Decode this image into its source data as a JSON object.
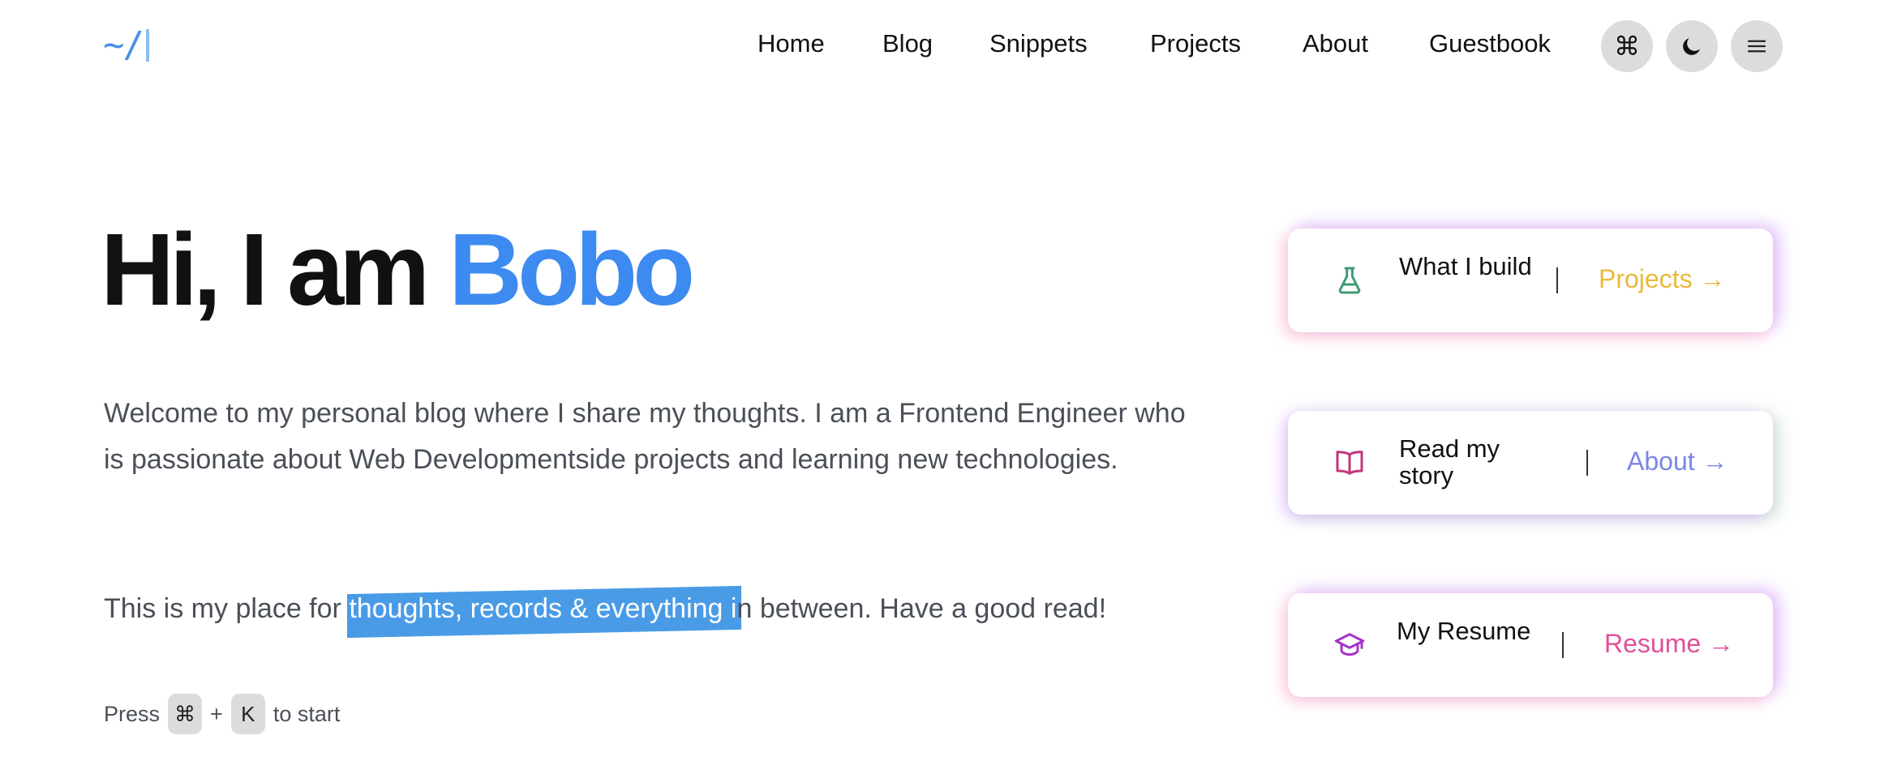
{
  "logo": {
    "text": "~/"
  },
  "nav": {
    "links": [
      {
        "label": "Home"
      },
      {
        "label": "Blog"
      },
      {
        "label": "Snippets"
      },
      {
        "label": "Projects"
      },
      {
        "label": "About"
      },
      {
        "label": "Guestbook"
      }
    ],
    "command_button": {
      "icon": "command-icon",
      "glyph": "⌘"
    },
    "theme_button": {
      "icon": "moon-icon"
    },
    "menu_button": {
      "icon": "hamburger-menu-icon"
    }
  },
  "hero": {
    "greeting": "Hi, I am",
    "name": "Bobo",
    "name_color": "#3d8af0",
    "intro": "Welcome to my personal blog where I share my thoughts. I am a Frontend Engineer who is passionate about Web Developmentside projects and learning new technologies.",
    "tagline_before": "This is my place for ",
    "tagline_highlight": "thoughts, records & everything i",
    "tagline_after": "n between. Have a good read!",
    "highlight_color": "#4a9be6"
  },
  "hint": {
    "press": "Press",
    "key1": "⌘",
    "plus": "+",
    "key2": "K",
    "suffix": "to start"
  },
  "cards": [
    {
      "icon": "flask-icon",
      "label": "What I build",
      "link": "Projects →",
      "link_color": "#e9b93a",
      "icon_color": "#3e9a73"
    },
    {
      "icon": "open-book-icon",
      "label": "Read my story",
      "link": "About →",
      "link_color": "#7b86e8",
      "icon_color": "#c2357a"
    },
    {
      "icon": "graduation-cap-icon",
      "label": "My Resume",
      "link": "Resume →",
      "link_color": "#e04f9a",
      "icon_color": "#a632c8"
    }
  ]
}
